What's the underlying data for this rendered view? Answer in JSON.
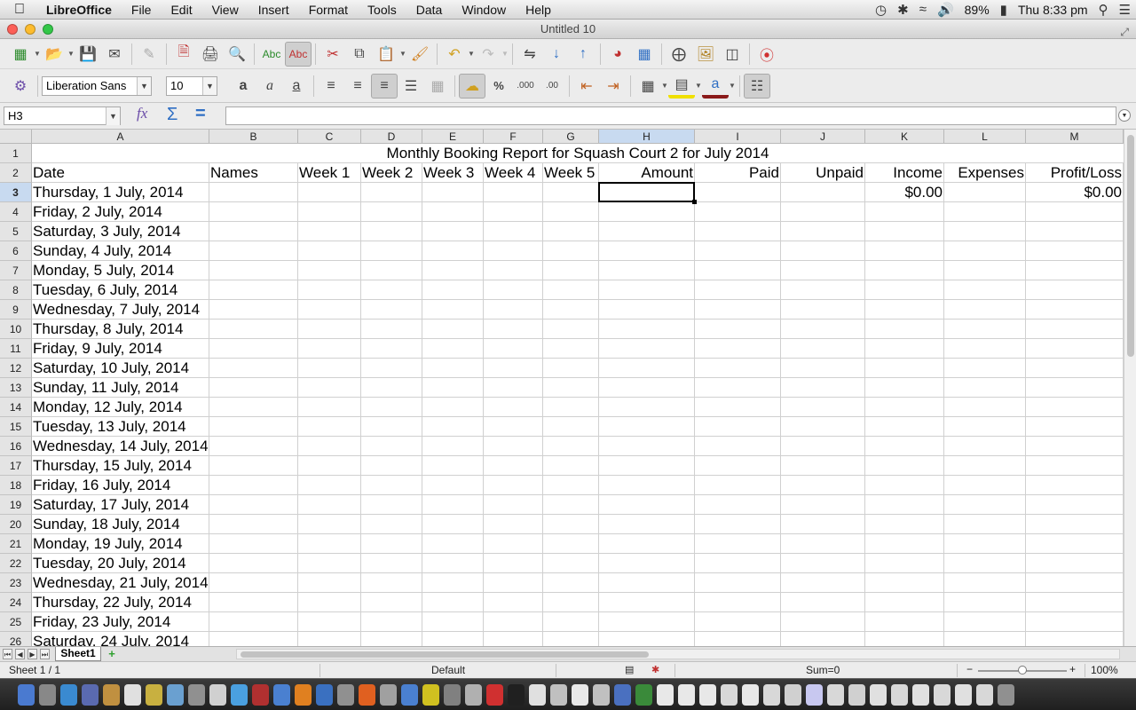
{
  "menubar": {
    "app_name": "LibreOffice",
    "items": [
      "File",
      "Edit",
      "View",
      "Insert",
      "Format",
      "Tools",
      "Data",
      "Window",
      "Help"
    ],
    "battery": "89%",
    "clock": "Thu 8:33 pm"
  },
  "window": {
    "title": "Untitled 10"
  },
  "formatting": {
    "font_name": "Liberation Sans",
    "font_size": "10"
  },
  "formula_bar": {
    "name_box": "H3",
    "formula": ""
  },
  "sheet": {
    "columns": [
      "A",
      "B",
      "C",
      "D",
      "E",
      "F",
      "G",
      "H",
      "I",
      "J",
      "K",
      "L",
      "M"
    ],
    "selected_column": "H",
    "selected_row": 3,
    "rows": [
      1,
      2,
      3,
      4,
      5,
      6,
      7,
      8,
      9,
      10,
      11,
      12,
      13,
      14,
      15,
      16,
      17,
      18,
      19,
      20,
      21,
      22,
      23,
      24,
      25,
      26
    ],
    "title": "Monthly Booking Report for Squash Court 2 for July 2014",
    "headers": {
      "A": "Date",
      "B": "Names",
      "C": "Week 1",
      "D": "Week 2",
      "E": "Week 3",
      "F": "Week 4",
      "G": "Week 5",
      "H": "Amount",
      "I": "Paid",
      "J": "Unpaid",
      "K": "Income",
      "L": "Expenses",
      "M": "Profit/Loss"
    },
    "dates": [
      "Thursday, 1 July, 2014",
      "Friday, 2 July, 2014",
      "Saturday, 3 July, 2014",
      "Sunday, 4 July, 2014",
      "Monday, 5 July, 2014",
      "Tuesday, 6 July, 2014",
      "Wednesday, 7 July, 2014",
      "Thursday, 8 July, 2014",
      "Friday, 9 July, 2014",
      "Saturday, 10 July, 2014",
      "Sunday, 11 July, 2014",
      "Monday, 12 July, 2014",
      "Tuesday, 13 July, 2014",
      "Wednesday, 14 July, 2014",
      "Thursday, 15 July, 2014",
      "Friday, 16 July, 2014",
      "Saturday, 17 July, 2014",
      "Sunday, 18 July, 2014",
      "Monday, 19 July, 2014",
      "Tuesday, 20 July, 2014",
      "Wednesday, 21 July, 2014",
      "Thursday, 22 July, 2014",
      "Friday, 23 July, 2014",
      "Saturday, 24 July, 2014"
    ],
    "row3_income": "$0.00",
    "row3_profit": "$0.00",
    "tab_name": "Sheet1"
  },
  "statusbar": {
    "sheet": "Sheet 1 / 1",
    "style": "Default",
    "sum": "Sum=0",
    "zoom": "100%"
  },
  "colors": {
    "accent": "#2f6fc4",
    "selection_header": "#c8daf0"
  }
}
